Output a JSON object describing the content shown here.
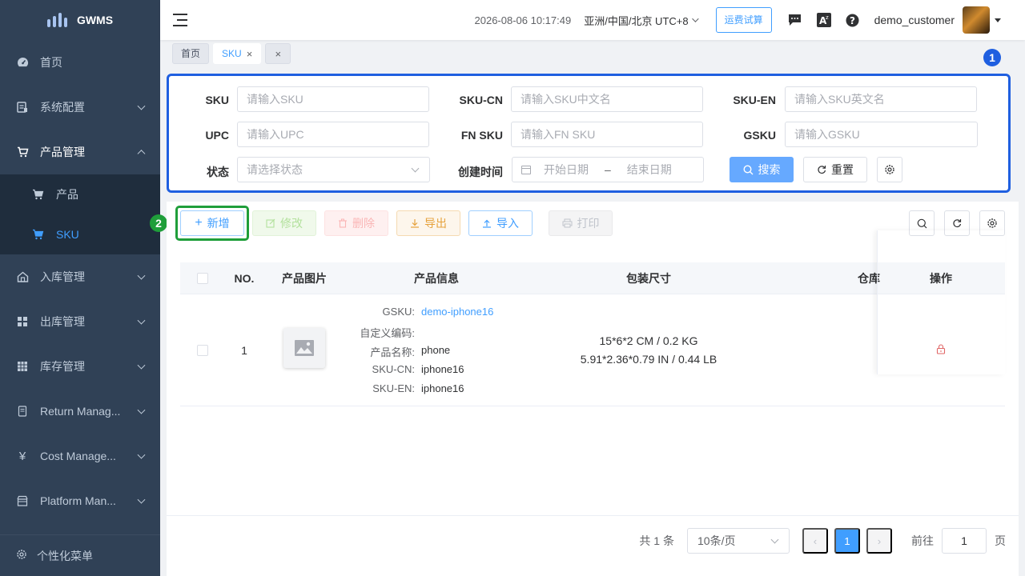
{
  "app": {
    "name": "GWMS"
  },
  "sidebar": {
    "items": [
      {
        "label": "首页"
      },
      {
        "label": "系统配置"
      },
      {
        "label": "产品管理"
      },
      {
        "label": "入库管理"
      },
      {
        "label": "出库管理"
      },
      {
        "label": "库存管理"
      },
      {
        "label": "Return Manag..."
      },
      {
        "label": "Cost Manage..."
      },
      {
        "label": "Platform Man..."
      }
    ],
    "subitems": [
      {
        "label": "产品"
      },
      {
        "label": "SKU"
      }
    ],
    "footer": "个性化菜单"
  },
  "header": {
    "datetime": "2026-08-06 10:17:49",
    "timezone": "亚洲/中国/北京 UTC+8",
    "freight_button": "运费试算",
    "username": "demo_customer"
  },
  "tags": [
    {
      "label": "首页"
    },
    {
      "label": "SKU",
      "close": "×"
    },
    {
      "close": "×"
    }
  ],
  "search": {
    "fields": {
      "sku": {
        "label": "SKU",
        "placeholder": "请输入SKU"
      },
      "sku_cn": {
        "label": "SKU-CN",
        "placeholder": "请输入SKU中文名"
      },
      "sku_en": {
        "label": "SKU-EN",
        "placeholder": "请输入SKU英文名"
      },
      "upc": {
        "label": "UPC",
        "placeholder": "请输入UPC"
      },
      "fn_sku": {
        "label": "FN SKU",
        "placeholder": "请输入FN SKU"
      },
      "gsku": {
        "label": "GSKU",
        "placeholder": "请输入GSKU"
      },
      "status": {
        "label": "状态",
        "placeholder": "请选择状态"
      },
      "created": {
        "label": "创建时间",
        "start": "开始日期",
        "sep": "–",
        "end": "结束日期"
      }
    },
    "search_button": "搜索",
    "reset_button": "重置",
    "annotation": "1"
  },
  "toolbar": {
    "add": "新增",
    "edit": "修改",
    "delete": "删除",
    "export": "导出",
    "import": "导入",
    "print": "打印",
    "annotation": "2"
  },
  "table": {
    "columns": [
      "NO.",
      "产品图片",
      "产品信息",
      "包装尺寸",
      "仓库",
      "操作"
    ],
    "rows": [
      {
        "no": "1",
        "info": [
          {
            "key": "GSKU:",
            "value": "demo-iphone16"
          },
          {
            "key": "自定义编码:",
            "value": ""
          },
          {
            "key": "产品名称:",
            "value": "phone"
          },
          {
            "key": "SKU-CN:",
            "value": "iphone16"
          },
          {
            "key": "SKU-EN:",
            "value": "iphone16"
          }
        ],
        "dims_metric": "15*6*2 CM / 0.2 KG",
        "dims_imperial": "5.91*2.36*0.79 IN / 0.44 LB"
      }
    ]
  },
  "pagination": {
    "total": "共 1 条",
    "page_size": "10条/页",
    "current": "1",
    "goto_label": "前往",
    "goto_value": "1",
    "page_suffix": "页"
  },
  "colors": {
    "sidebar_bg": "#304156",
    "accent": "#409eff",
    "annotation_blue": "#1f5fe0",
    "annotation_green": "#1f9e3a"
  }
}
